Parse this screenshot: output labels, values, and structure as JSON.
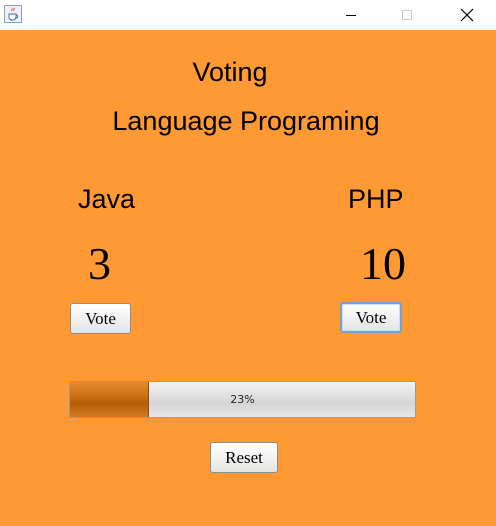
{
  "window": {
    "icons": {
      "app": "java-cup-icon",
      "minimize": "minimize-icon",
      "maximize": "maximize-icon",
      "close": "close-icon"
    }
  },
  "header": {
    "title": "Voting",
    "subtitle": "Language Programing"
  },
  "candidates": [
    {
      "name": "Java",
      "votes": "3",
      "vote_label": "Vote"
    },
    {
      "name": "PHP",
      "votes": "10",
      "vote_label": "Vote"
    }
  ],
  "progress": {
    "value": 0.23,
    "label": "23%"
  },
  "reset_label": "Reset",
  "colors": {
    "background": "#ff9933",
    "progress_fill": "#c96c10",
    "progress_track": "#dedede",
    "focused_button_border": "#7a9fcf"
  }
}
